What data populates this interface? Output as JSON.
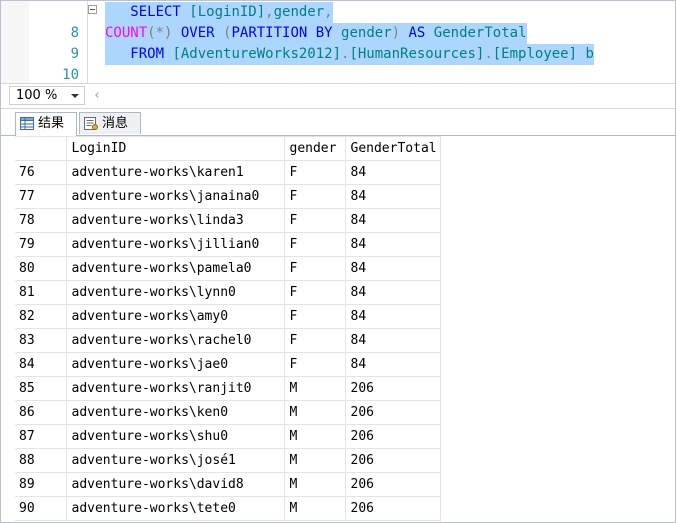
{
  "editor": {
    "lines": [
      {
        "number": "8",
        "tokens": [
          {
            "text": "   SELECT ",
            "cls": "kw"
          },
          {
            "text": "[LoginID]",
            "cls": "ob"
          },
          {
            "text": ",",
            "cls": "op"
          },
          {
            "text": "gender",
            "cls": "ob"
          },
          {
            "text": ",",
            "cls": "op"
          }
        ]
      },
      {
        "number": "9",
        "tokens": [
          {
            "text": "COUNT",
            "cls": "fn"
          },
          {
            "text": "(*) ",
            "cls": "op"
          },
          {
            "text": "OVER ",
            "cls": "kw"
          },
          {
            "text": "(",
            "cls": "op"
          },
          {
            "text": "PARTITION BY ",
            "cls": "kw"
          },
          {
            "text": "gender",
            "cls": "ob"
          },
          {
            "text": ") ",
            "cls": "op"
          },
          {
            "text": "AS ",
            "cls": "kw"
          },
          {
            "text": "GenderTotal",
            "cls": "ob"
          }
        ]
      },
      {
        "number": "10",
        "tokens": [
          {
            "text": "   FROM ",
            "cls": "kw"
          },
          {
            "text": "[AdventureWorks2012]",
            "cls": "ob"
          },
          {
            "text": ".",
            "cls": "op"
          },
          {
            "text": "[HumanResources]",
            "cls": "ob"
          },
          {
            "text": ".",
            "cls": "op"
          },
          {
            "text": "[Employee] ",
            "cls": "ob"
          },
          {
            "text": "b",
            "cls": "ob"
          }
        ]
      }
    ]
  },
  "zoom": {
    "value": "100 %"
  },
  "tabs": [
    {
      "label": "结果",
      "icon": "grid-icon",
      "active": true
    },
    {
      "label": "消息",
      "icon": "messages-icon",
      "active": false
    }
  ],
  "results": {
    "columns": [
      "LoginID",
      "gender",
      "GenderTotal"
    ],
    "rows": [
      {
        "n": "76",
        "login": "adventure-works\\karen1",
        "gender": "F",
        "total": "84"
      },
      {
        "n": "77",
        "login": "adventure-works\\janaina0",
        "gender": "F",
        "total": "84"
      },
      {
        "n": "78",
        "login": "adventure-works\\linda3",
        "gender": "F",
        "total": "84"
      },
      {
        "n": "79",
        "login": "adventure-works\\jillian0",
        "gender": "F",
        "total": "84"
      },
      {
        "n": "80",
        "login": "adventure-works\\pamela0",
        "gender": "F",
        "total": "84"
      },
      {
        "n": "81",
        "login": "adventure-works\\lynn0",
        "gender": "F",
        "total": "84"
      },
      {
        "n": "82",
        "login": "adventure-works\\amy0",
        "gender": "F",
        "total": "84"
      },
      {
        "n": "83",
        "login": "adventure-works\\rachel0",
        "gender": "F",
        "total": "84"
      },
      {
        "n": "84",
        "login": "adventure-works\\jae0",
        "gender": "F",
        "total": "84"
      },
      {
        "n": "85",
        "login": "adventure-works\\ranjit0",
        "gender": "M",
        "total": "206"
      },
      {
        "n": "86",
        "login": "adventure-works\\ken0",
        "gender": "M",
        "total": "206"
      },
      {
        "n": "87",
        "login": "adventure-works\\shu0",
        "gender": "M",
        "total": "206"
      },
      {
        "n": "88",
        "login": "adventure-works\\josé1",
        "gender": "M",
        "total": "206"
      },
      {
        "n": "89",
        "login": "adventure-works\\david8",
        "gender": "M",
        "total": "206"
      },
      {
        "n": "90",
        "login": "adventure-works\\tete0",
        "gender": "M",
        "total": "206"
      }
    ]
  },
  "colors": {
    "selection": "#add6ff",
    "keyword": "#0000ff",
    "function": "#ff00ff",
    "object": "#008080",
    "operator": "#808080",
    "line_number": "#2b91af"
  }
}
